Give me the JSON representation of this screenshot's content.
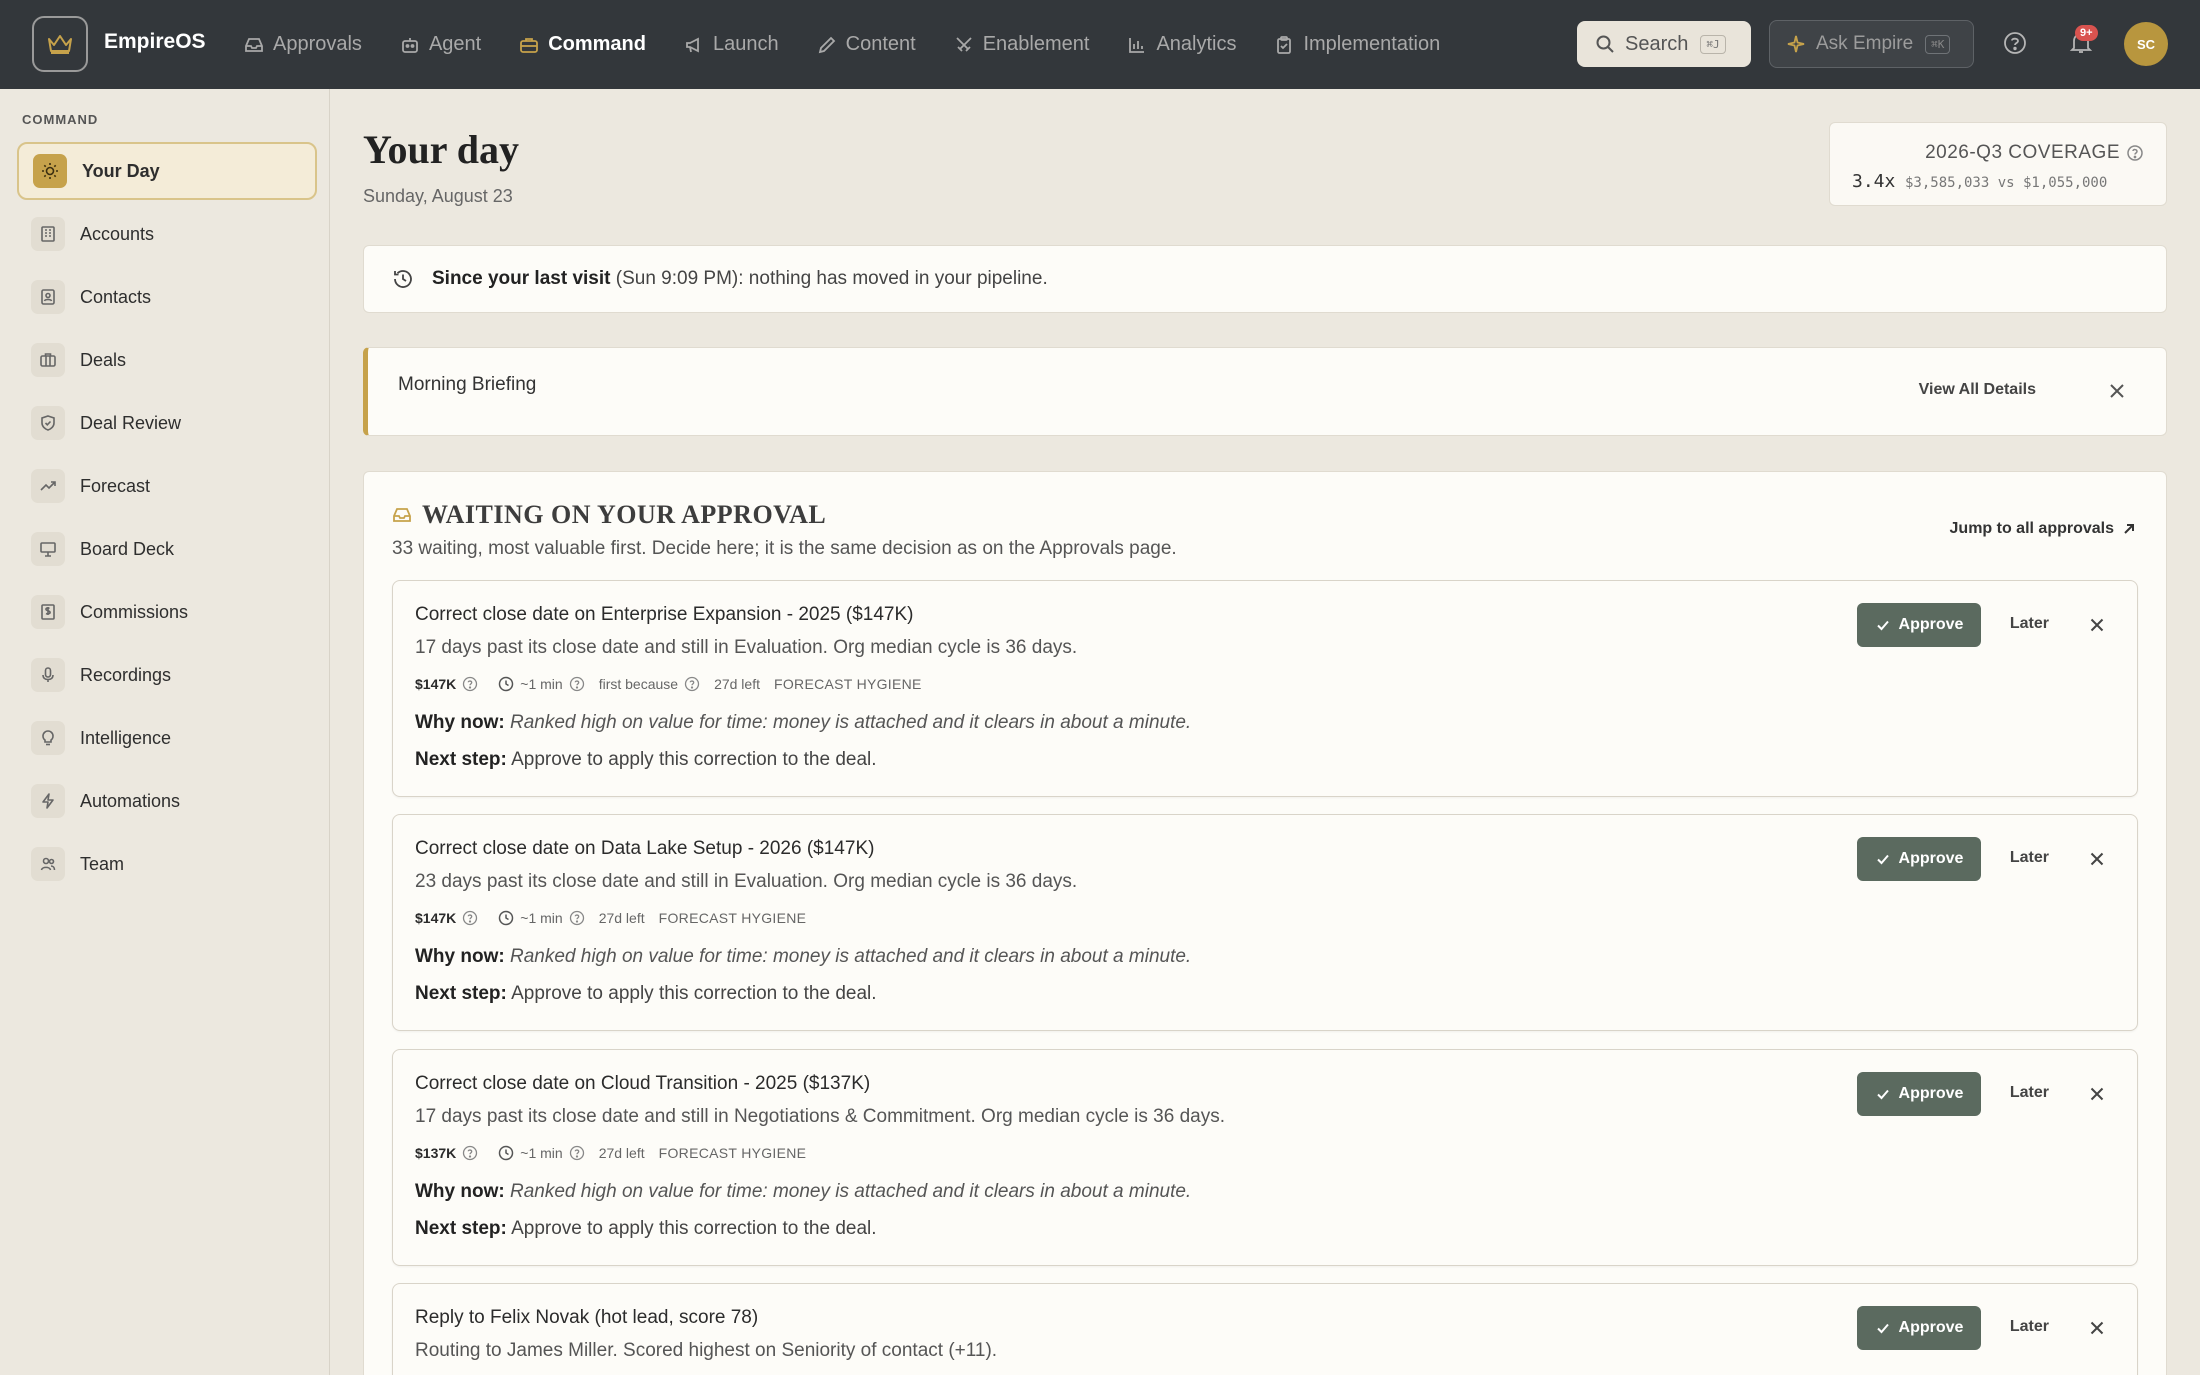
{
  "app": {
    "brand": "EmpireOS"
  },
  "nav": {
    "items": [
      {
        "label": "Approvals",
        "icon": "inbox-icon"
      },
      {
        "label": "Agent",
        "icon": "bot-icon"
      },
      {
        "label": "Command",
        "icon": "briefcase-icon",
        "active": true
      },
      {
        "label": "Launch",
        "icon": "megaphone-icon"
      },
      {
        "label": "Content",
        "icon": "pencil-icon"
      },
      {
        "label": "Enablement",
        "icon": "swords-icon"
      },
      {
        "label": "Analytics",
        "icon": "bar-chart-icon"
      },
      {
        "label": "Implementation",
        "icon": "clipboard-icon"
      }
    ],
    "search_label": "Search",
    "search_shortcut": "⌘J",
    "ask_label": "Ask Empire",
    "ask_shortcut": "⌘K",
    "notification_count": "9+",
    "avatar_initials": "SC"
  },
  "sidebar": {
    "heading": "COMMAND",
    "items": [
      {
        "label": "Your Day",
        "icon": "sun-icon",
        "active": true
      },
      {
        "label": "Accounts",
        "icon": "building-icon"
      },
      {
        "label": "Contacts",
        "icon": "contact-card-icon"
      },
      {
        "label": "Deals",
        "icon": "briefcase-icon"
      },
      {
        "label": "Deal Review",
        "icon": "shield-check-icon"
      },
      {
        "label": "Forecast",
        "icon": "trending-up-icon"
      },
      {
        "label": "Board Deck",
        "icon": "presentation-icon"
      },
      {
        "label": "Commissions",
        "icon": "receipt-icon"
      },
      {
        "label": "Recordings",
        "icon": "microphone-icon"
      },
      {
        "label": "Intelligence",
        "icon": "lightbulb-icon"
      },
      {
        "label": "Automations",
        "icon": "lightning-icon"
      },
      {
        "label": "Team",
        "icon": "users-icon"
      }
    ]
  },
  "header": {
    "title": "Your day",
    "date": "Sunday, August 23"
  },
  "coverage": {
    "title": "2026-Q3 COVERAGE",
    "value": "3.4x",
    "detail": "$3,585,033 vs $1,055,000"
  },
  "since_visit": {
    "label": "Since your last visit",
    "time": "(Sun 9:09 PM)",
    "message": ": nothing has moved in your pipeline."
  },
  "briefing": {
    "title": "Morning Briefing",
    "view_all": "View All Details"
  },
  "approvals": {
    "title": "WAITING ON YOUR APPROVAL",
    "subtitle": "33 waiting, most valuable first. Decide here; it is the same decision as on the Approvals page.",
    "jump_label": "Jump to all approvals",
    "approve_label": "Approve",
    "later_label": "Later",
    "why_label": "Why now:",
    "next_label": "Next step:",
    "cards": [
      {
        "title": "Correct close date on Enterprise Expansion - 2025 ($147K)",
        "description": "17 days past its close date and still in Evaluation. Org median cycle is 36 days.",
        "amount": "$147K",
        "time": "~1 min",
        "first_because": "first because",
        "days_left": "27d left",
        "category": "FORECAST HYGIENE",
        "why": "Ranked high on value for time: money is attached and it clears in about a minute.",
        "next": "Approve to apply this correction to the deal."
      },
      {
        "title": "Correct close date on Data Lake Setup - 2026 ($147K)",
        "description": "23 days past its close date and still in Evaluation. Org median cycle is 36 days.",
        "amount": "$147K",
        "time": "~1 min",
        "days_left": "27d left",
        "category": "FORECAST HYGIENE",
        "why": "Ranked high on value for time: money is attached and it clears in about a minute.",
        "next": "Approve to apply this correction to the deal."
      },
      {
        "title": "Correct close date on Cloud Transition - 2025 ($137K)",
        "description": "17 days past its close date and still in Negotiations & Commitment. Org median cycle is 36 days.",
        "amount": "$137K",
        "time": "~1 min",
        "days_left": "27d left",
        "category": "FORECAST HYGIENE",
        "why": "Ranked high on value for time: money is attached and it clears in about a minute.",
        "next": "Approve to apply this correction to the deal."
      },
      {
        "title": "Reply to Felix Novak (hot lead, score 78)",
        "description": "Routing to James Miller. Scored highest on Seniority of contact (+11)."
      }
    ]
  },
  "colors": {
    "topbar": "#33373b",
    "accent_gold": "#c6a24b",
    "approve_green": "#5b6a5f",
    "page_bg": "#ece8df",
    "card_bg": "#fdfcf8"
  }
}
